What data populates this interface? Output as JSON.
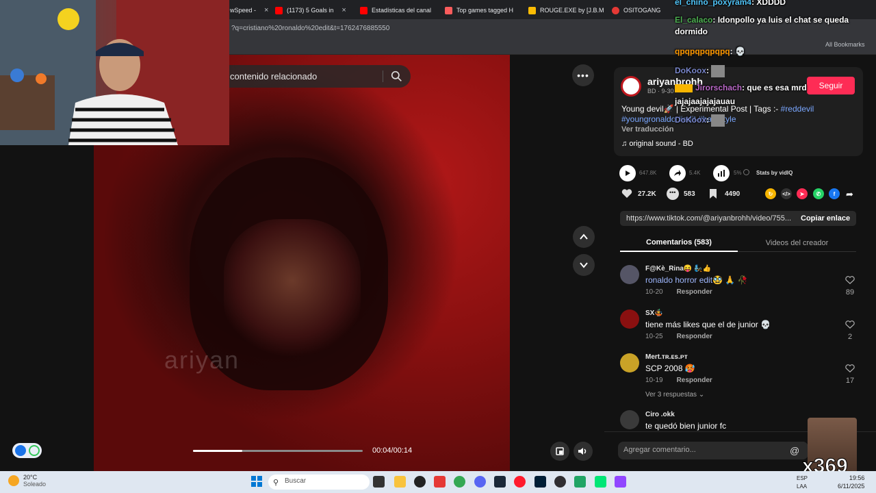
{
  "browser": {
    "tabs": [
      {
        "label": "wSpeed -",
        "color": "#4285f4"
      },
      {
        "label": "(1173) 5 Goals in",
        "color": "#ff0000"
      },
      {
        "label": "Estadísticas del canal",
        "color": "#ff0000"
      },
      {
        "label": "Top games tagged H",
        "color": "#fa5c5c"
      },
      {
        "label": "ROUGE.EXE by [J.B.M",
        "color": "#fbbc04"
      },
      {
        "label": "OSITOGANG",
        "color": "#e53935"
      }
    ],
    "url": "?q=cristiano%20ronaldo%20edit&t=1762476885550",
    "bookmarks_label": "All Bookmarks"
  },
  "video": {
    "search_placeholder": "contenido relacionado",
    "watermark": "ariyan",
    "progress": 0.29,
    "time": "00:04/00:14"
  },
  "post": {
    "username": "ariyanbrohh",
    "subline": "BD · 9-30",
    "follow_label": "Seguir",
    "description_prefix": "Young devil🚀 | Experimental Post | Tags :- ",
    "tag1": "#reddevil",
    "tag2": "#youngronaldo",
    "desc_mid": " ",
    "tag3": "#edit",
    "tag4": "#hardstyle",
    "translate_label": "Ver traducción",
    "sound": "original sound - BD",
    "plays": "647.8K",
    "shares_count": "5.4K",
    "engagement": "5%",
    "stats_by": "Stats by vidIQ",
    "likes": "27.2K",
    "comments_count": "583",
    "saves": "4490",
    "link": "https://www.tiktok.com/@ariyanbrohh/video/755...",
    "copy_label": "Copiar enlace",
    "tab_comments": "Comentarios (583)",
    "tab_videos": "Videos del creador",
    "add_comment_placeholder": "Agregar comentario..."
  },
  "comments": [
    {
      "user": "F@Kè_Rina😝 🧞👍",
      "text": "ronaldo horror edit🥸 🙏 🥀",
      "date": "10-20",
      "reply": "Responder",
      "likes": "89",
      "avatar": "#556"
    },
    {
      "user": "SX🤹",
      "text": "tiene más likes que el de junior 💀",
      "date": "10-25",
      "reply": "Responder",
      "likes": "2",
      "avatar": "#8a1010"
    },
    {
      "user": "Mert.ᴛʀ.ᴇs.ᴘᴛ",
      "text": "SCP 2008 🥵",
      "date": "10-19",
      "reply": "Responder",
      "likes": "17",
      "avatar": "#c9a227",
      "more": "Ver 3 respuestas"
    },
    {
      "user": "Ciro .okk",
      "text": "te quedó bien junior fc",
      "avatar": "#3a3a3a"
    }
  ],
  "chat": [
    {
      "user": "el_chino_poxyram4",
      "user_color": "#4fc3f7",
      "text": ": XDDDD"
    },
    {
      "user": "El_calaco",
      "user_color": "#4caf50",
      "text": ": Idonpollo ya luis el chat se queda"
    },
    {
      "user": "",
      "user_color": "#fff",
      "text": "dormido"
    },
    {
      "user": "qpqpqpqpqpq",
      "user_color": "#ff9800",
      "text": ": 💀"
    },
    {
      "user": "DoKoox",
      "user_color": "#7986cb",
      "text": ":"
    },
    {
      "user": "Jirorschach",
      "user_color": "#ba68c8",
      "text": ": que es esa mrd"
    },
    {
      "user": "",
      "user_color": "#fff",
      "text": "jajajaajajajauau"
    },
    {
      "user": "DoKoox",
      "user_color": "#7986cb",
      "text": ":"
    }
  ],
  "overlay": {
    "counter": "x369"
  },
  "taskbar": {
    "temp": "20°C",
    "weather": "Soleado",
    "search": "Buscar",
    "lang1": "ESP",
    "lang2": "LAA",
    "time": "19:56",
    "date": "6/11/2025"
  }
}
